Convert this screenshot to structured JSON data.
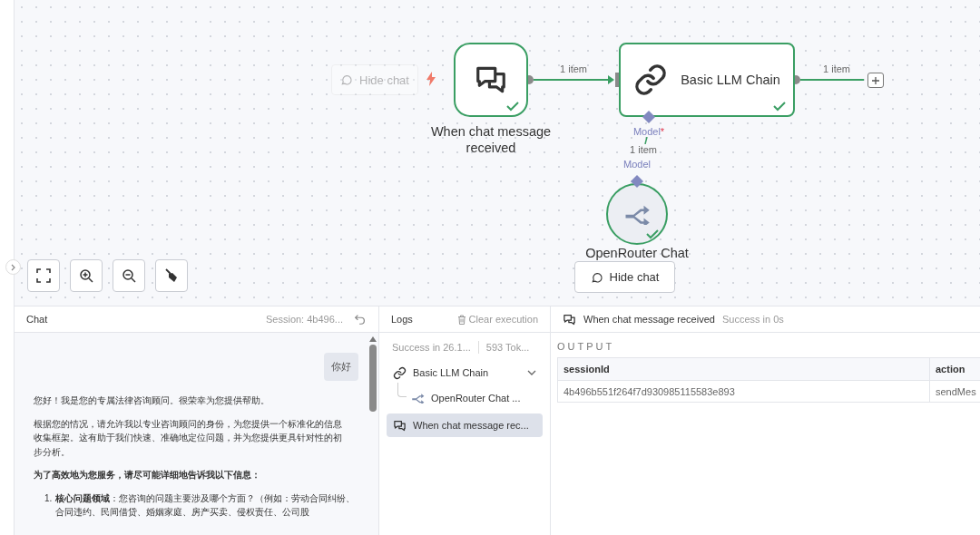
{
  "canvas": {
    "ghost_button": {
      "label": "Hide chat"
    },
    "nodes": [
      {
        "kind": "trigger",
        "label": "When chat message received",
        "success": true
      },
      {
        "kind": "chain",
        "label": "Basic LLM Chain",
        "success": true
      },
      {
        "kind": "model",
        "label": "OpenRouter Chat",
        "success": true
      }
    ],
    "edges": [
      {
        "kind": "main",
        "label": "1 item"
      },
      {
        "kind": "out",
        "label": "1 item"
      },
      {
        "kind": "model",
        "label": "1 item",
        "input_label": "Model",
        "required_mark": "*",
        "output_label": "Model"
      }
    ],
    "hide_chat_button": {
      "label": "Hide chat"
    }
  },
  "chat": {
    "title": "Chat",
    "session": "Session: 4b496...",
    "messages": [
      {
        "kind": "user",
        "text": "你好"
      },
      {
        "kind": "bot",
        "blocks": [
          {
            "kind": "p",
            "text": "您好！我是您的专属法律咨询顾问。很荣幸为您提供帮助。"
          },
          {
            "kind": "p",
            "text": "根据您的情况，请允许我以专业咨询顾问的身份，为您提供一个标准化的信息收集框架。这有助于我们快速、准确地定位问题，并为您提供更具针对性的初步分析。"
          },
          {
            "kind": "bold",
            "text": "为了高效地为您服务，请尽可能详细地告诉我以下信息："
          },
          {
            "kind": "list",
            "number": "1.",
            "text": "**核心问题领域**：您咨询的问题主要涉及哪个方面？（例如：劳动合同纠纷、合同违约、民间借贷、婚姻家庭、房产买卖、侵权责任、公司股"
          }
        ]
      }
    ]
  },
  "logs": {
    "title": "Logs",
    "clear": "Clear execution",
    "summary": [
      "Success in 26.1...",
      "593 Tok..."
    ],
    "items": [
      {
        "kind": "link",
        "label": "Basic LLM Chain",
        "selected": false,
        "expanded": true,
        "children": [
          {
            "kind": "router",
            "label": "OpenRouter Chat ...",
            "selected": false
          }
        ]
      },
      {
        "kind": "chat",
        "label": "When chat message rec...",
        "selected": true
      }
    ]
  },
  "output": {
    "node": "When chat message received",
    "status": "Success in 0s",
    "heading": "OUTPUT",
    "table": {
      "columns": [
        "sessionId",
        "action"
      ],
      "rows": [
        [
          "4b496b551f264f7d930985115583e893",
          "sendMes"
        ]
      ]
    }
  }
}
